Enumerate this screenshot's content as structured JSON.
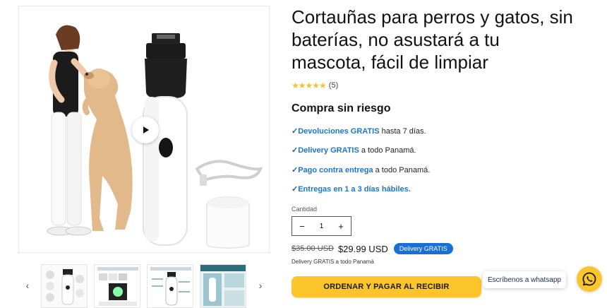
{
  "product": {
    "title": "Cortauñas para perros y gatos, sin baterías, no asustará a tu mascota, fácil de limpiar",
    "rating_stars": "★★★★★",
    "rating_count": "(5)",
    "rating_value": 5
  },
  "guarantee": {
    "heading": "Compra sin riesgo",
    "items": [
      {
        "check": "✓",
        "highlight": "Devoluciones GRATIS",
        "rest": " hasta 7 días."
      },
      {
        "check": "✓",
        "highlight": "Delivery GRATIS",
        "rest": " a todo Panamá."
      },
      {
        "check": "✓",
        "highlight": "Pago contra entrega",
        "rest": " a todo Panamá."
      },
      {
        "check": "✓",
        "highlight": "Entregas en 1 a 3 días hábiles.",
        "rest": ""
      }
    ]
  },
  "quantity": {
    "label": "Cantidad",
    "value": "1",
    "minus": "−",
    "plus": "+"
  },
  "price": {
    "old": "$35.00 USD",
    "current": "$29.99 USD",
    "badge": "Delivery GRATIS",
    "note": "Delivery GRATIS a todo Panamá"
  },
  "cta": {
    "label": "ORDENAR Y PAGAR AL RECIBIR"
  },
  "gallery": {
    "prev": "‹",
    "next": "›",
    "thumb_count": 4
  },
  "whatsapp": {
    "label": "Escríbenos a whatsapp",
    "icon": "whatsapp-icon"
  },
  "colors": {
    "accent": "#fbc52b",
    "link_blue": "#1976d2",
    "badge_blue": "#1a6fd6",
    "star": "#f2c33a"
  }
}
